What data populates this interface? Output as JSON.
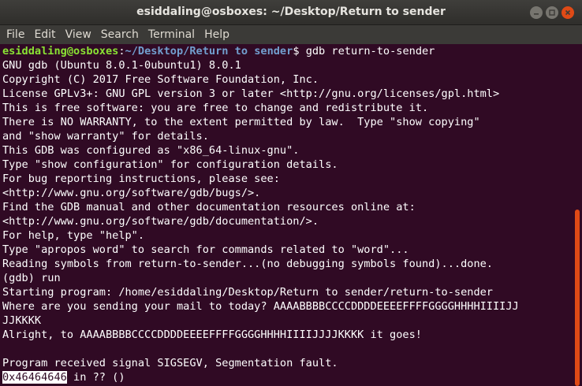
{
  "window": {
    "title": "esiddaling@osboxes: ~/Desktop/Return to sender"
  },
  "menu": [
    "File",
    "Edit",
    "View",
    "Search",
    "Terminal",
    "Help"
  ],
  "prompt": {
    "user_host": "esiddaling@osboxes",
    "separator": ":",
    "path": "~/Desktop/Return to sender",
    "symbol": "$ ",
    "command": "gdb return-to-sender"
  },
  "output": [
    "GNU gdb (Ubuntu 8.0.1-0ubuntu1) 8.0.1",
    "Copyright (C) 2017 Free Software Foundation, Inc.",
    "License GPLv3+: GNU GPL version 3 or later <http://gnu.org/licenses/gpl.html>",
    "This is free software: you are free to change and redistribute it.",
    "There is NO WARRANTY, to the extent permitted by law.  Type \"show copying\"",
    "and \"show warranty\" for details.",
    "This GDB was configured as \"x86_64-linux-gnu\".",
    "Type \"show configuration\" for configuration details.",
    "For bug reporting instructions, please see:",
    "<http://www.gnu.org/software/gdb/bugs/>.",
    "Find the GDB manual and other documentation resources online at:",
    "<http://www.gnu.org/software/gdb/documentation/>.",
    "For help, type \"help\".",
    "Type \"apropos word\" to search for commands related to \"word\"...",
    "Reading symbols from return-to-sender...(no debugging symbols found)...done.",
    "(gdb) run",
    "Starting program: /home/esiddaling/Desktop/Return to sender/return-to-sender",
    "Where are you sending your mail to today? AAAABBBBCCCCDDDDEEEEFFFFGGGGHHHHIIIIJJ",
    "JJKKKK",
    "Alright, to AAAABBBBCCCCDDDDEEEEFFFFGGGGHHHHIIIIJJJJKKKK it goes!",
    "",
    "Program received signal SIGSEGV, Segmentation fault."
  ],
  "fault": {
    "address": "0x46464646",
    "rest": " in ?? ()"
  },
  "colors": {
    "background": "#300a24",
    "prompt_user": "#8ae234",
    "prompt_path": "#729fcf",
    "accent": "#df4a16"
  }
}
